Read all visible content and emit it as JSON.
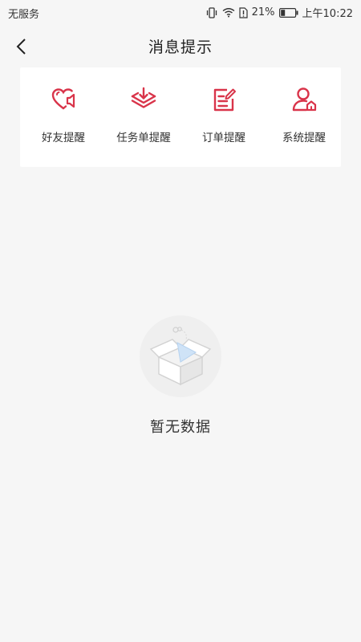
{
  "status_bar": {
    "carrier": "无服务",
    "battery_percent": "21%",
    "time": "上午10:22",
    "icons": [
      "vibrate-icon",
      "wifi-icon",
      "sim-alert-icon",
      "battery-icon"
    ]
  },
  "nav": {
    "back_icon": "chevron-left-icon",
    "title": "消息提示"
  },
  "categories": [
    {
      "label": "好友提醒",
      "icon": "heart-speaker-icon"
    },
    {
      "label": "任务单提醒",
      "icon": "layers-download-icon"
    },
    {
      "label": "订单提醒",
      "icon": "order-edit-icon"
    },
    {
      "label": "系统提醒",
      "icon": "user-home-icon"
    }
  ],
  "empty_state": {
    "text": "暂无数据",
    "icon": "empty-box-icon"
  },
  "colors": {
    "accent": "#d9344a",
    "background": "#f6f6f6",
    "card": "#ffffff"
  }
}
